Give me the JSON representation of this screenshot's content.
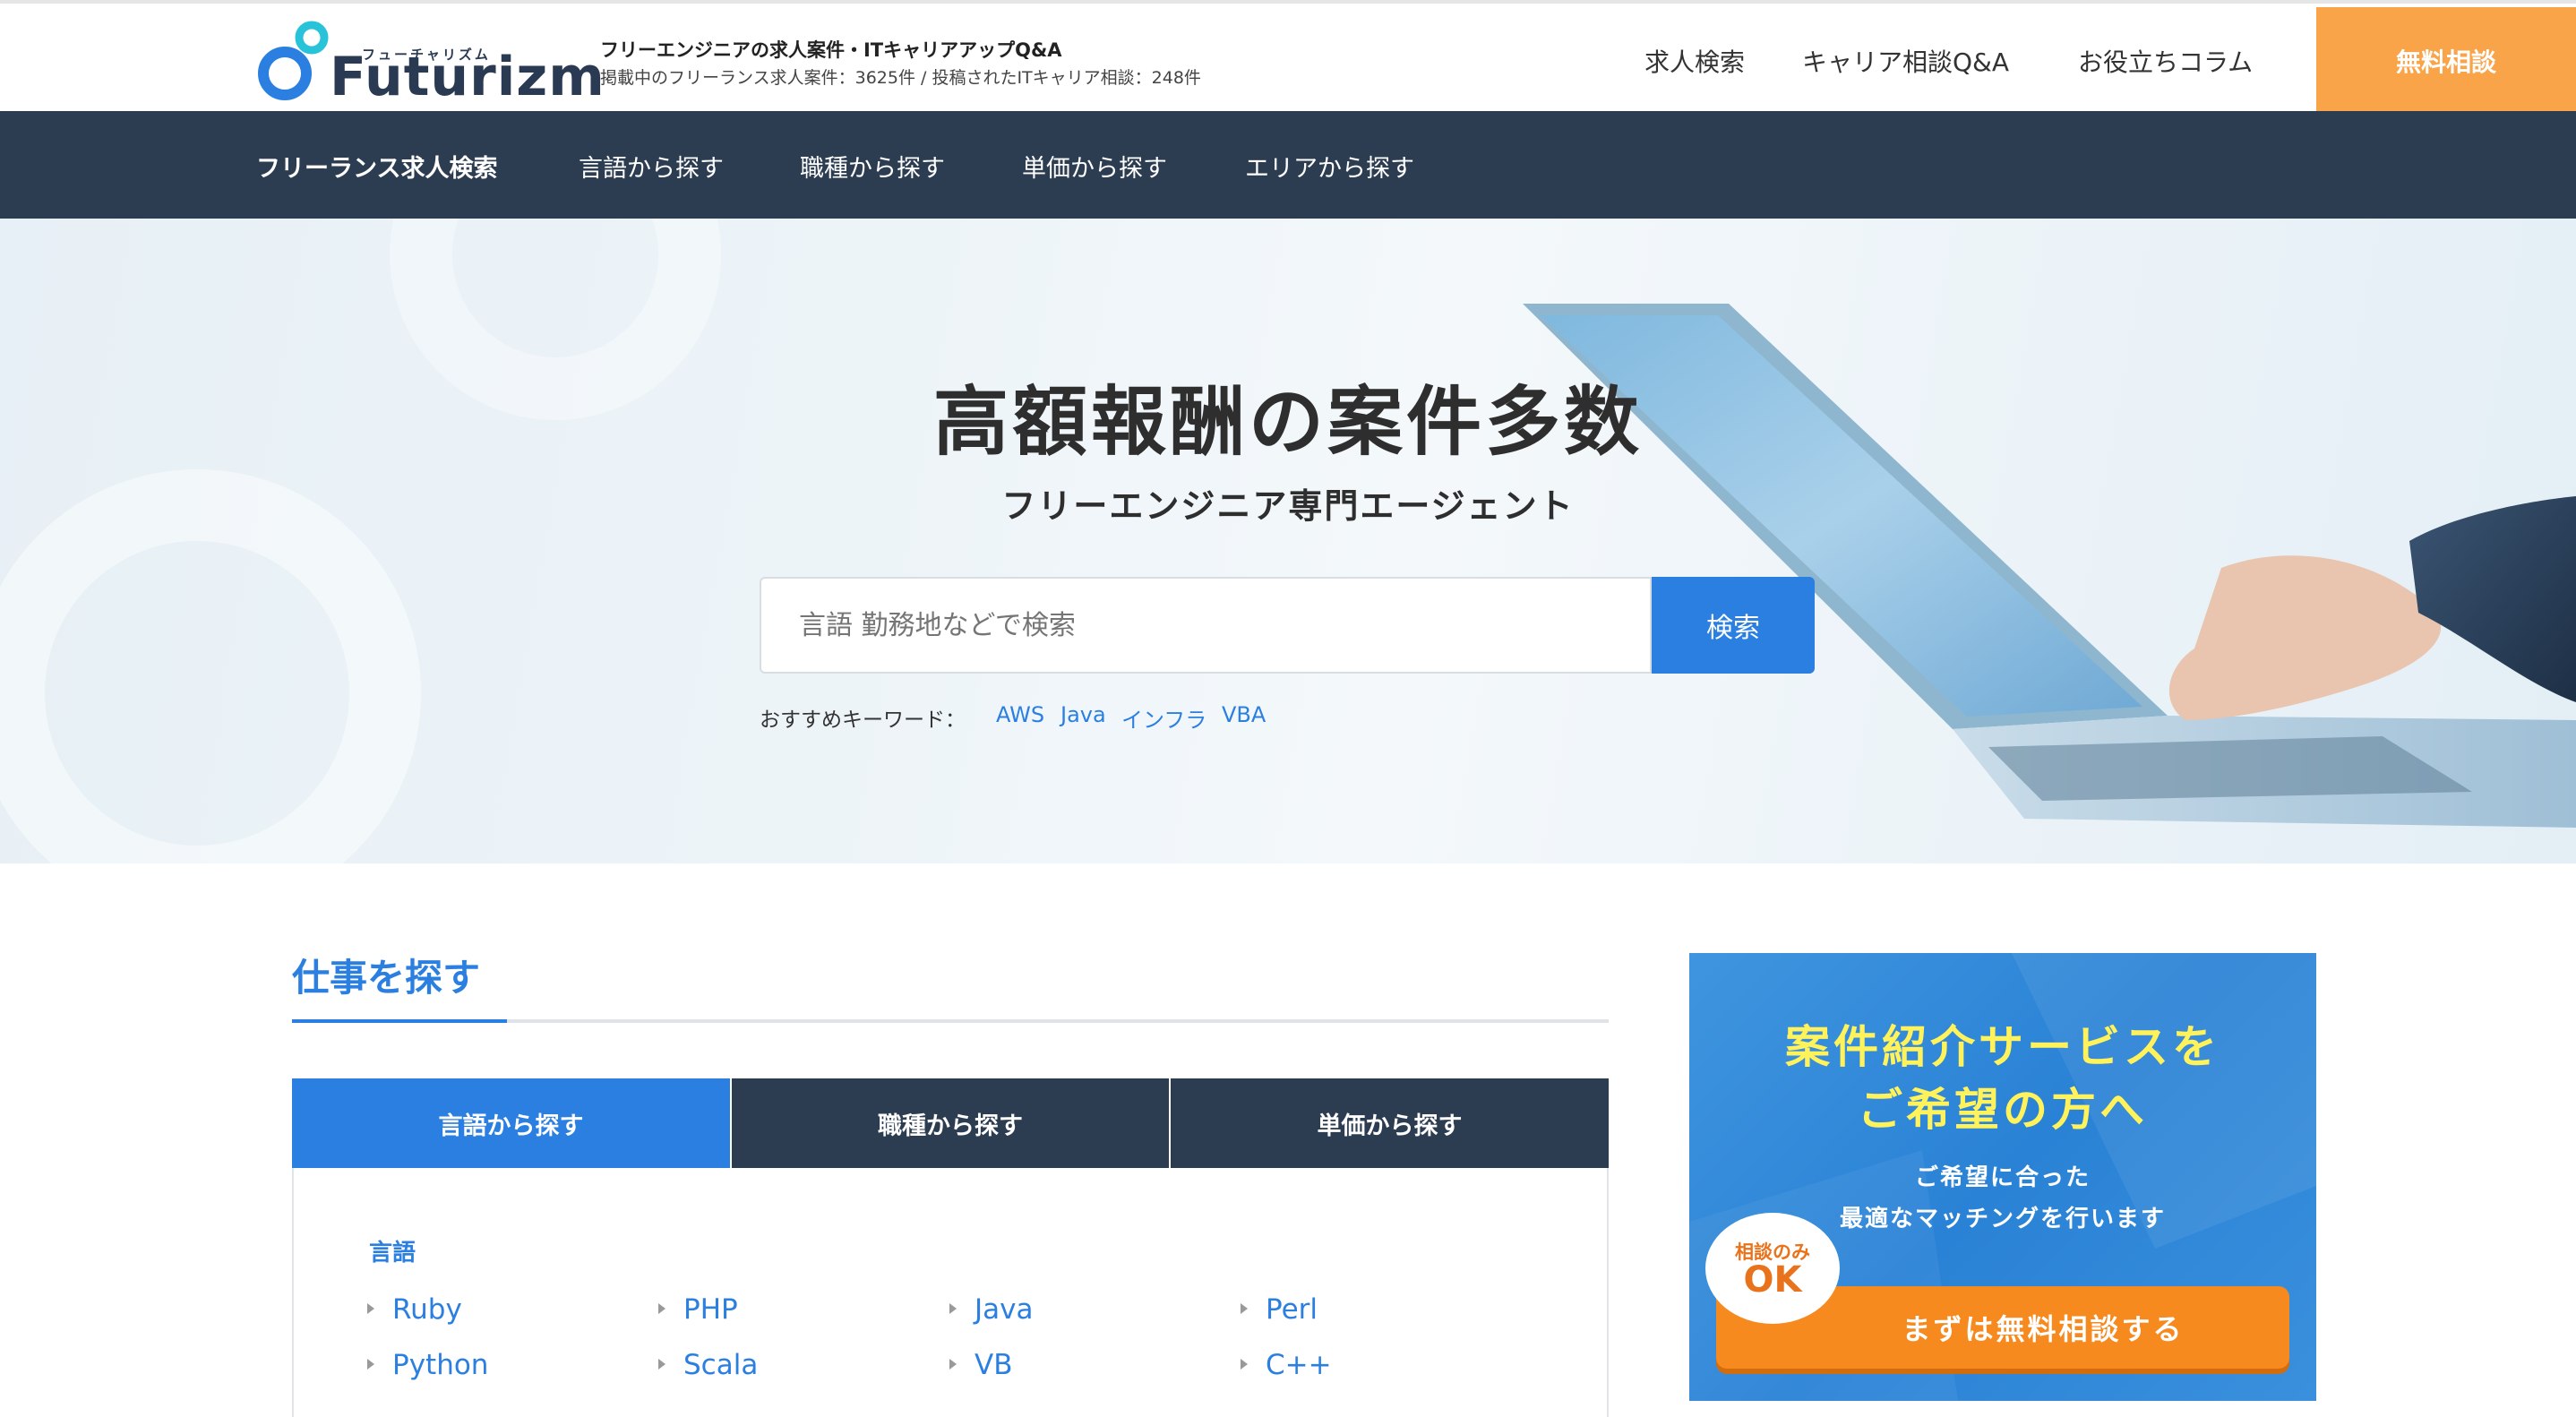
{
  "header": {
    "logo_sub": "フューチャリズム",
    "logo_text": "Futurizm",
    "tagline": "フリーエンジニアの求人案件・ITキャリアアップQ&A",
    "stats": "掲載中のフリーランス求人案件：3625件 / 投稿されたITキャリア相談：248件",
    "nav": [
      "求人検索",
      "キャリア相談Q&A",
      "お役立ちコラム"
    ],
    "cta": "無料相談"
  },
  "darknav": {
    "items": [
      "フリーランス求人検索",
      "言語から探す",
      "職種から探す",
      "単価から探す",
      "エリアから探す"
    ]
  },
  "hero": {
    "title": "高額報酬の案件多数",
    "subtitle": "フリーエンジニア専門エージェント",
    "search_placeholder": "言語 勤務地などで検索",
    "search_button": "検索",
    "keywords_label": "おすすめキーワード：",
    "keywords": [
      "AWS",
      "Java",
      "インフラ",
      "VBA"
    ]
  },
  "jobs": {
    "title": "仕事を探す",
    "tabs": [
      "言語から探す",
      "職種から探す",
      "単価から探す"
    ],
    "active_tab": 0,
    "group_label": "言語",
    "languages": [
      "Ruby",
      "PHP",
      "Java",
      "Perl",
      "Python",
      "Scala",
      "VB",
      "C++"
    ]
  },
  "banner": {
    "title_line1": "案件紹介サービスを",
    "title_line2": "ご希望の方へ",
    "desc_line1": "ご希望に合った",
    "desc_line2": "最適なマッチングを行います",
    "badge_small": "相談のみ",
    "badge_big": "OK",
    "button": "まずは無料相談する"
  },
  "colors": {
    "brand_blue": "#2b7fe0",
    "navy": "#2c3d52",
    "cta_orange": "#f9a448",
    "banner_yellow": "#fff25a"
  }
}
